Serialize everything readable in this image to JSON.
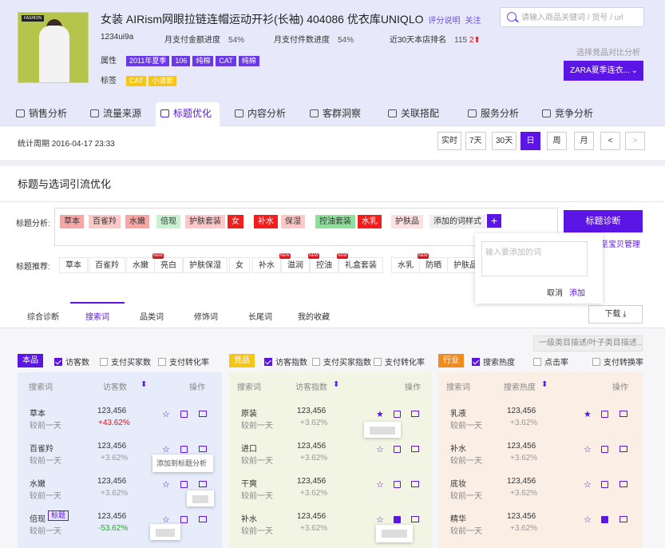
{
  "product": {
    "brand_mark": "FASHION",
    "title": "女装 AIRism网眼拉链连帽运动开衫(长袖) 404086 优衣库UNIQLO",
    "rating_link": "评分说明",
    "follow_link": "关注",
    "shop": "1234ui9a",
    "pay_amount_label": "月支付金额进度",
    "pay_amount_value": "54%",
    "pay_count_label": "月支付件数进度",
    "pay_count_value": "54%",
    "rank_label": "近30天本店排名",
    "rank_value": "115",
    "rank_change": "2⬆",
    "attr_label": "属性",
    "attrs": [
      "2011年夏季",
      "106",
      "纯棉",
      "CAT",
      "纯棉"
    ],
    "tag_label": "标签",
    "tags": [
      "CAT",
      "小清新"
    ]
  },
  "search": {
    "placeholder": "请输入商品关键词 / 货号 / url"
  },
  "compare": {
    "label": "选择竞品对比分析",
    "selected": "ZARA夏季连衣..."
  },
  "nav_tabs": [
    "销售分析",
    "流量来源",
    "标题优化",
    "内容分析",
    "客群洞察",
    "关联搭配",
    "服务分析",
    "竞争分析"
  ],
  "period": {
    "text": "统计周期 2016-04-17 23:33",
    "buttons": [
      "实时",
      "7天",
      "30天",
      "日",
      "周",
      "月"
    ]
  },
  "section_title": "标题与选词引流优化",
  "analysis": {
    "label": "标题分析:",
    "words": [
      "草本",
      "百雀羚",
      "水嫩",
      "倍现",
      "护肤套装",
      "女",
      "补水",
      "保湿",
      "控油套装",
      "水乳",
      "护肤品",
      "添加的词样式"
    ],
    "diagnose_btn": "标题诊断",
    "step_link": "步至宝贝管理"
  },
  "recommend": {
    "label": "标题推荐:",
    "words": [
      "草本",
      "百雀羚",
      "水嫩",
      "亮白",
      "护肤保湿",
      "女",
      "补水",
      "滋润",
      "控油",
      "礼盒套装",
      "水乳",
      "防晒",
      "护肤品"
    ],
    "new_badge": "NEW"
  },
  "popup": {
    "placeholder": "输入要添加的词",
    "cancel": "取消",
    "add": "添加"
  },
  "sub_tabs": [
    "综合诊断",
    "搜索词",
    "品类词",
    "修饰词",
    "长尾词",
    "我的收藏"
  ],
  "download": "下载",
  "desc_box": "一级类目描述/叶子类目描述...",
  "panels": [
    {
      "pill": "本品",
      "pill_color": "#5b16e6",
      "checks": [
        "访客数",
        "支付买家数",
        "支付转化率"
      ],
      "headers": [
        "搜索词",
        "访客数",
        "操作"
      ],
      "rows": [
        {
          "kw": "草本",
          "sub": "较前一天",
          "num": "123,456",
          "chg": "+43.62%"
        },
        {
          "kw": "百雀羚",
          "sub": "较前一天",
          "num": "123,456",
          "chg": "+3.62%"
        },
        {
          "kw": "水嫩",
          "sub": "较前一天",
          "num": "123,456",
          "chg": "+3.62%"
        },
        {
          "kw": "倍现",
          "tag": "标题",
          "sub": "较前一天",
          "num": "123,456",
          "chg": "-53.62%"
        }
      ]
    },
    {
      "pill": "竞品",
      "pill_color": "#f5c518",
      "checks": [
        "访客指数",
        "支付买家指数",
        "支付转化率"
      ],
      "headers": [
        "搜索词",
        "访客指数",
        "操作"
      ],
      "rows": [
        {
          "kw": "原装",
          "sub": "较前一天",
          "num": "123,456",
          "chg": "+3.62%"
        },
        {
          "kw": "进口",
          "sub": "较前一天",
          "num": "123,456",
          "chg": "+3.62%"
        },
        {
          "kw": "干爽",
          "sub": "较前一天",
          "num": "123,456",
          "chg": "+3.62%"
        },
        {
          "kw": "补水",
          "sub": "较前一天",
          "num": "123,456",
          "chg": "+3.62%"
        }
      ]
    },
    {
      "pill": "行业",
      "pill_color": "#f08c1e",
      "checks": [
        "搜索热度",
        "点击率",
        "支付转换率"
      ],
      "headers": [
        "搜索词",
        "搜索热度",
        "操作"
      ],
      "rows": [
        {
          "kw": "乳液",
          "sub": "较前一天",
          "num": "123,456",
          "chg": "+3.62%"
        },
        {
          "kw": "补水",
          "sub": "较前一天",
          "num": "123,456",
          "chg": "+3.62%"
        },
        {
          "kw": "底妆",
          "sub": "较前一天",
          "num": "123,456",
          "chg": "+3.62%"
        },
        {
          "kw": "精华",
          "sub": "较前一天",
          "num": "123,456",
          "chg": "+3.62%"
        }
      ]
    }
  ],
  "tooltips": [
    "添加到标题分析"
  ]
}
